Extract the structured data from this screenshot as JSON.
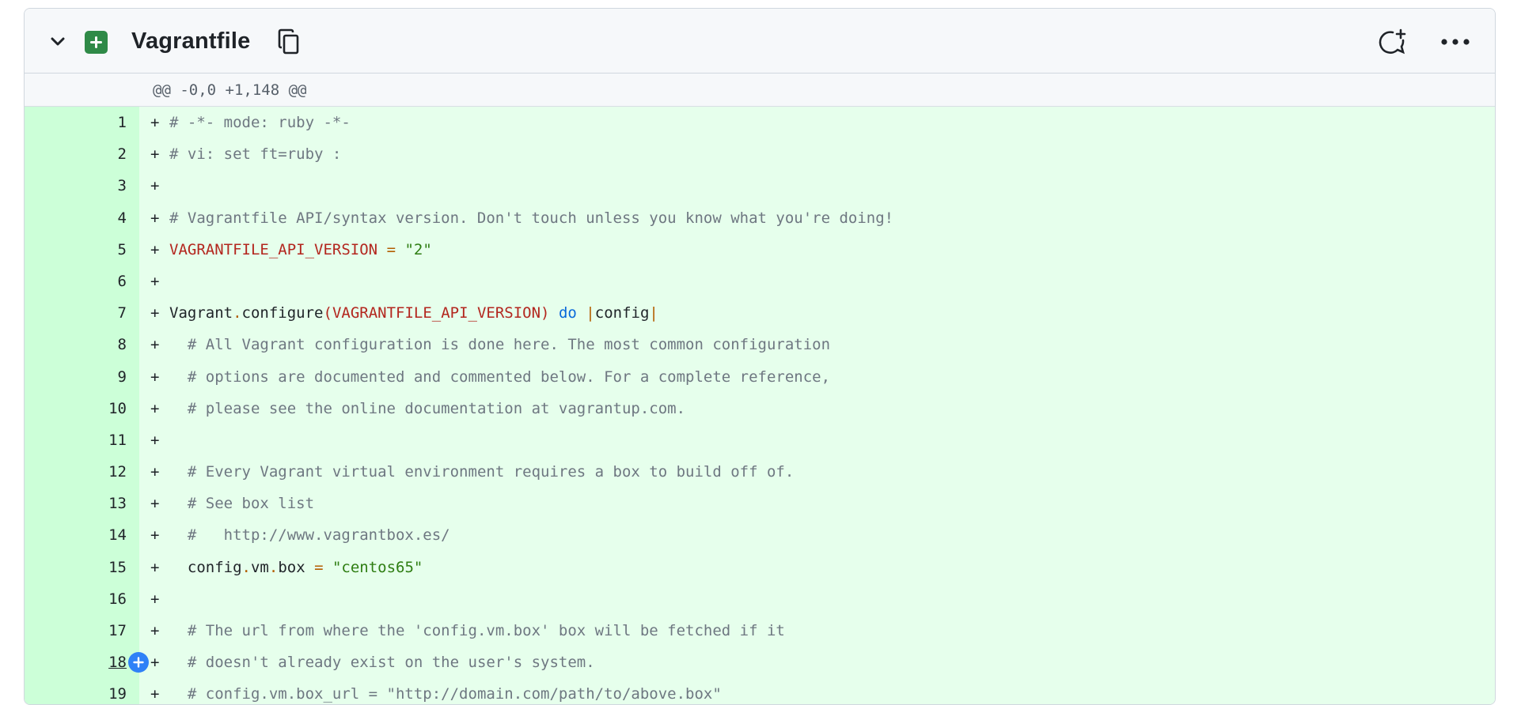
{
  "file": {
    "name": "Vagrantfile",
    "status_icon": "file-added-icon",
    "hunk_header": "@@ -0,0 +1,148 @@"
  },
  "lines": [
    {
      "n": "1",
      "m": "+",
      "t": "# -*- mode: ruby -*-"
    },
    {
      "n": "2",
      "m": "+",
      "t": "# vi: set ft=ruby :"
    },
    {
      "n": "3",
      "m": "+",
      "t": ""
    },
    {
      "n": "4",
      "m": "+",
      "t": "# Vagrantfile API/syntax version. Don't touch unless you know what you're doing!"
    },
    {
      "n": "5",
      "m": "+",
      "t": "VAGRANTFILE_API_VERSION = \"2\""
    },
    {
      "n": "6",
      "m": "+",
      "t": ""
    },
    {
      "n": "7",
      "m": "+",
      "t": "Vagrant.configure(VAGRANTFILE_API_VERSION) do |config|"
    },
    {
      "n": "8",
      "m": "+",
      "t": "  # All Vagrant configuration is done here. The most common configuration"
    },
    {
      "n": "9",
      "m": "+",
      "t": "  # options are documented and commented below. For a complete reference,"
    },
    {
      "n": "10",
      "m": "+",
      "t": "  # please see the online documentation at vagrantup.com."
    },
    {
      "n": "11",
      "m": "+",
      "t": ""
    },
    {
      "n": "12",
      "m": "+",
      "t": "  # Every Vagrant virtual environment requires a box to build off of."
    },
    {
      "n": "13",
      "m": "+",
      "t": "  # See box list"
    },
    {
      "n": "14",
      "m": "+",
      "t": "  #   http://www.vagrantbox.es/"
    },
    {
      "n": "15",
      "m": "+",
      "t": "  config.vm.box = \"centos65\""
    },
    {
      "n": "16",
      "m": "+",
      "t": ""
    },
    {
      "n": "17",
      "m": "+",
      "t": "  # The url from where the 'config.vm.box' box will be fetched if it"
    },
    {
      "n": "18",
      "m": "+",
      "t": "  # doesn't already exist on the user's system."
    },
    {
      "n": "19",
      "m": "+",
      "t": "  # config.vm.box_url = \"http://domain.com/path/to/above.box\""
    }
  ],
  "hovered_line": "18",
  "colors": {
    "added_bg": "#e6ffec",
    "added_gutter": "#ccffd8",
    "added_icon": "#2f8a47",
    "comment_button": "#2f81f7"
  }
}
